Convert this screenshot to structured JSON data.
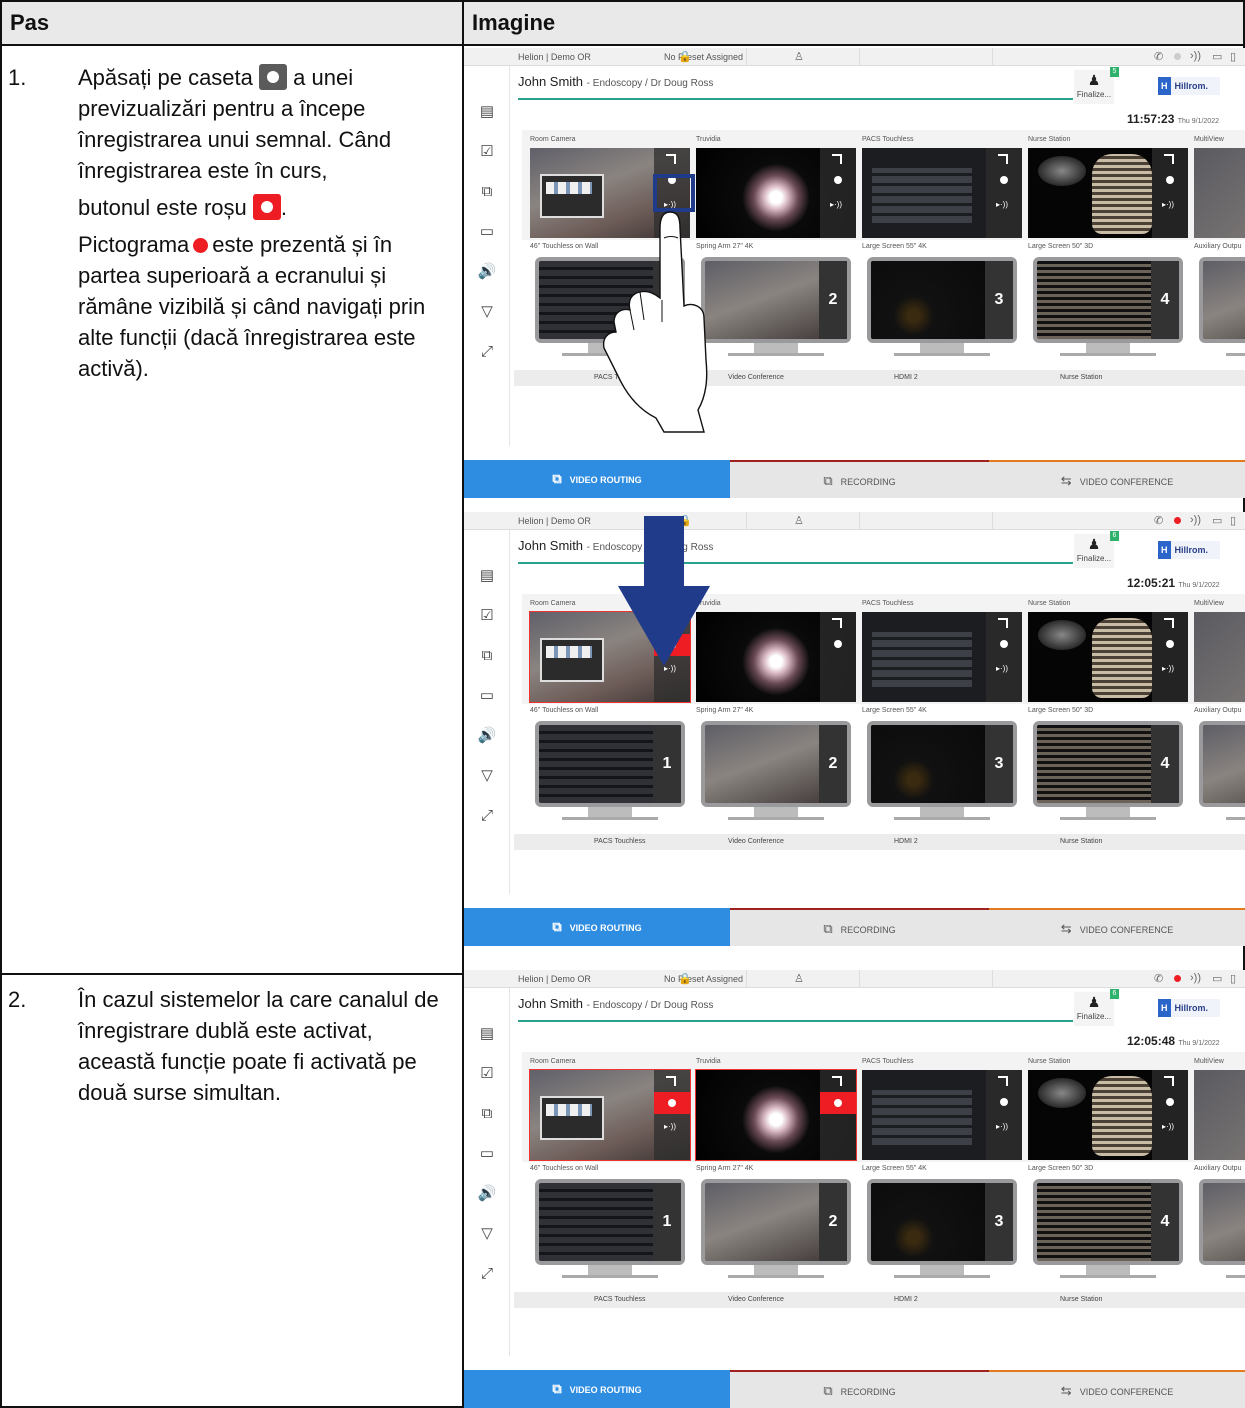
{
  "table": {
    "header": {
      "step_col": "Pas",
      "image_col": "Imagine"
    }
  },
  "steps": [
    {
      "number": "1.",
      "paragraphs": {
        "p1_a": "Apăsați pe caseta",
        "p1_b": "a unei previzualizări pentru a începe înregistrarea unui semnal. Când înregistrarea este în curs,",
        "p2_a": "butonul este roșu",
        "p2_b": ".",
        "p3_a": "Pictograma",
        "p3_b": "este prezentă și în partea superioară a ecranului și rămâne vizibilă și când navigați prin alte funcții (dacă înregistrarea este activă)."
      }
    },
    {
      "number": "2.",
      "paragraphs": {
        "p1": "În cazul sistemelor la care canalul de înregistrare dublă este activat, această funcție poate fi activată pe două surse simultan."
      }
    }
  ],
  "ui": {
    "room": "Helion | Demo OR",
    "preset": "No Preset Assigned",
    "patient_name": "John Smith",
    "patient_detail": "- Endoscopy / Dr Doug Ross",
    "finalize": "Finalize...",
    "logo": "Hillrom.",
    "logo_mark": "H",
    "sources": [
      "Room Camera",
      "Truvidia",
      "PACS Touchless",
      "Nurse Station",
      "MultiView"
    ],
    "destinations": [
      "46\" Touchless on Wall",
      "Spring Arm 27\" 4K",
      "Large Screen 55\" 4K",
      "Large Screen 50\" 3D",
      "Auxiliary Outpu"
    ],
    "dest_labels": [
      "PACS Touchless",
      "Video Conference",
      "HDMI 2",
      "Nurse Station"
    ],
    "dest_numbers": [
      "1",
      "2",
      "3",
      "4"
    ],
    "tabs": [
      "VIDEO ROUTING",
      "RECORDING",
      "VIDEO CONFERENCE"
    ],
    "panels": [
      {
        "time": "11:57:23",
        "date": "Thu 9/1/2022",
        "badge": "5"
      },
      {
        "time": "12:05:21",
        "date": "Thu 9/1/2022",
        "badge": "6"
      },
      {
        "time": "12:05:48",
        "date": "Thu 9/1/2022",
        "badge": "6"
      }
    ]
  },
  "colors": {
    "record_red": "#ee1d23",
    "tab_active": "#2e8de1",
    "highlight_blue": "#1f3b8a",
    "header_bg": "#e9e9ea"
  }
}
